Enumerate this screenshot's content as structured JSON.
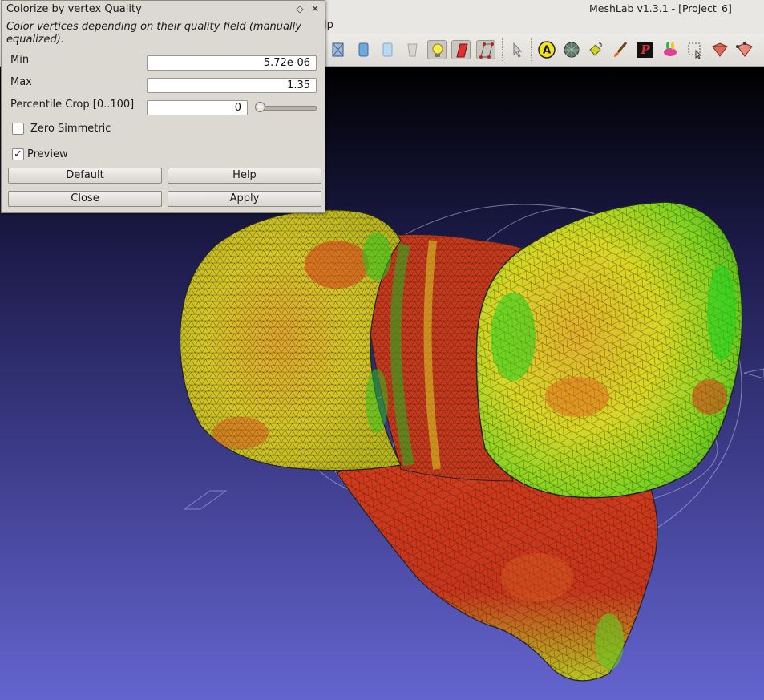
{
  "window": {
    "title": "MeshLab v1.3.1 - [Project_6]",
    "menu_partial": "lp"
  },
  "toolbar": {
    "icons": [
      "box-icon",
      "cylinder-icon",
      "cylinder-light-icon",
      "mesh-gray-icon",
      "light-bulb-icon",
      "red-box-icon",
      "vertex-box-icon",
      "pointer-icon",
      "annotation-icon",
      "sphere-icon",
      "bucket-icon",
      "brush-icon",
      "pp-icon",
      "bunny-icon",
      "select-icon",
      "select-faces-icon",
      "select-vertices-icon"
    ],
    "pressed": [
      "light-bulb-icon",
      "red-box-icon",
      "vertex-box-icon"
    ],
    "annotation_glyph": "A"
  },
  "dialog": {
    "title": "Colorize by vertex Quality",
    "description": "Color vertices depending on their quality field (manually equalized).",
    "min_label": "Min",
    "min_value": "5.72e-06",
    "max_label": "Max",
    "max_value": "1.35",
    "percentile_label": "Percentile Crop [0..100]",
    "percentile_value": "0",
    "zero_symmetric_label": "Zero Simmetric",
    "zero_symmetric_checked": false,
    "preview_label": "Preview",
    "preview_checked": true,
    "check_glyph": "✓",
    "buttons": {
      "default": "Default",
      "help": "Help",
      "close": "Close",
      "apply": "Apply"
    },
    "float_glyph": "◇",
    "close_glyph": "✕"
  },
  "colors": {
    "viewport_top": "#000000",
    "viewport_bottom": "#6464cf",
    "mesh_red": "#d8301a",
    "mesh_yellow": "#e8d91f",
    "mesh_green": "#1fd01f"
  }
}
